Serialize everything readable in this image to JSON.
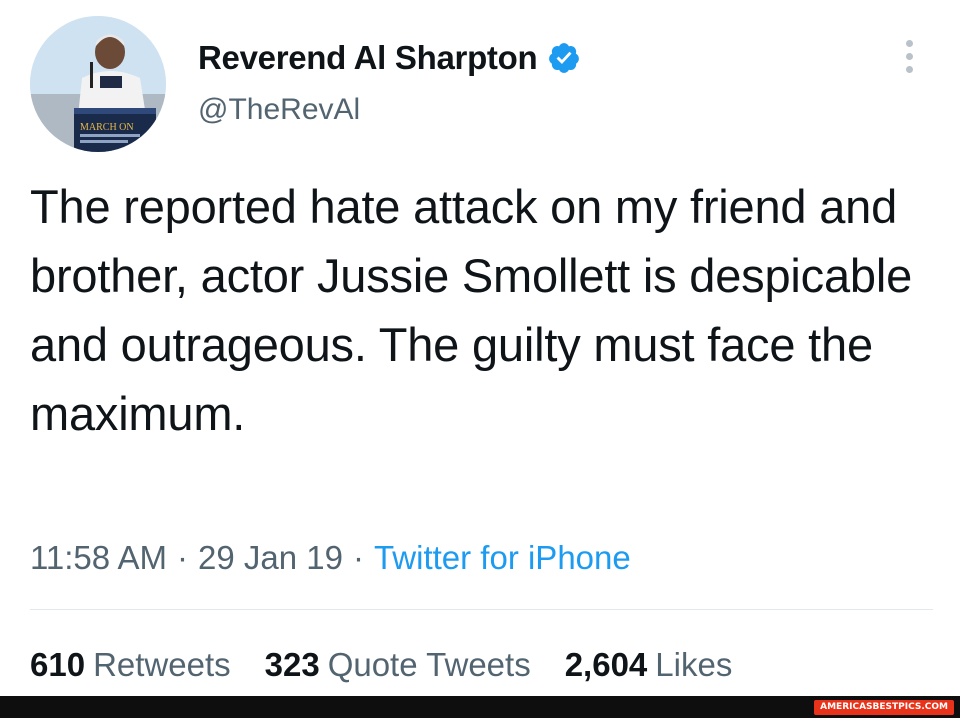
{
  "author": {
    "display_name": "Reverend Al Sharpton",
    "handle": "@TheRevAl",
    "verified": true,
    "avatar_icon": "profile-photo",
    "avatar_podium_text": "MARCH ON"
  },
  "tweet": {
    "text": "The reported hate attack on my friend and brother, actor Jussie Smollett is despicable and outrageous. The guilty must face the maximum.",
    "time": "11:58 AM",
    "date": "29 Jan 19",
    "source": "Twitter for iPhone",
    "separator": "·"
  },
  "stats": {
    "retweets": {
      "count": "610",
      "label": "Retweets"
    },
    "quote_tweets": {
      "count": "323",
      "label": "Quote Tweets"
    },
    "likes": {
      "count": "2,604",
      "label": "Likes"
    }
  },
  "watermark": {
    "text": "AMERICASBESTPICS.COM"
  },
  "colors": {
    "text_primary": "#0f1419",
    "text_secondary": "#536471",
    "link_blue": "#1d9bf0",
    "verified_blue": "#1d9bf0",
    "divider": "#e3e8eb"
  },
  "icons": {
    "verified": "verified-badge-icon",
    "more": "more-options-icon"
  }
}
